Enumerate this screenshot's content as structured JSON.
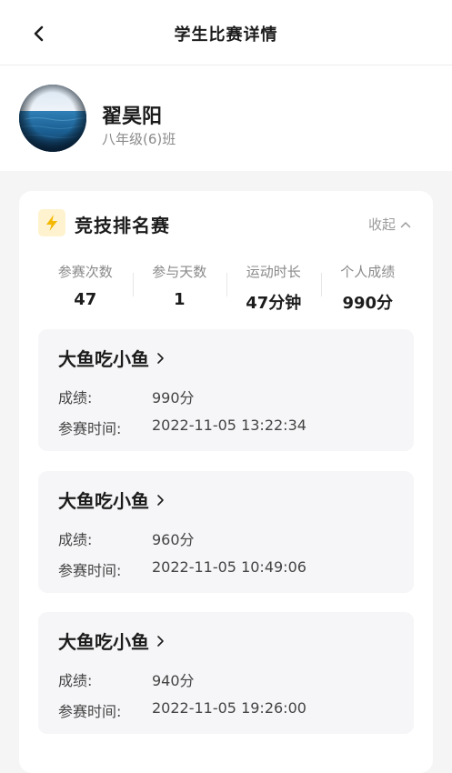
{
  "header": {
    "title": "学生比赛详情",
    "back_icon": "chevron-left-icon"
  },
  "student": {
    "name": "翟昊阳",
    "class": "八年级(6)班"
  },
  "competition": {
    "title": "竞技排名赛",
    "collapse_label": "收起",
    "accent_color": "#f5b800",
    "stats": [
      {
        "label": "参赛次数",
        "value": "47"
      },
      {
        "label": "参与天数",
        "value": "1"
      },
      {
        "label": "运动时长",
        "value": "47分钟"
      },
      {
        "label": "个人成绩",
        "value": "990分"
      }
    ],
    "entries": [
      {
        "game": "大鱼吃小鱼",
        "score_label": "成绩:",
        "score": "990分",
        "time_label": "参赛时间:",
        "time": "2022-11-05 13:22:34"
      },
      {
        "game": "大鱼吃小鱼",
        "score_label": "成绩:",
        "score": "960分",
        "time_label": "参赛时间:",
        "time": "2022-11-05 10:49:06"
      },
      {
        "game": "大鱼吃小鱼",
        "score_label": "成绩:",
        "score": "940分",
        "time_label": "参赛时间:",
        "time": "2022-11-05 19:26:00"
      }
    ]
  }
}
